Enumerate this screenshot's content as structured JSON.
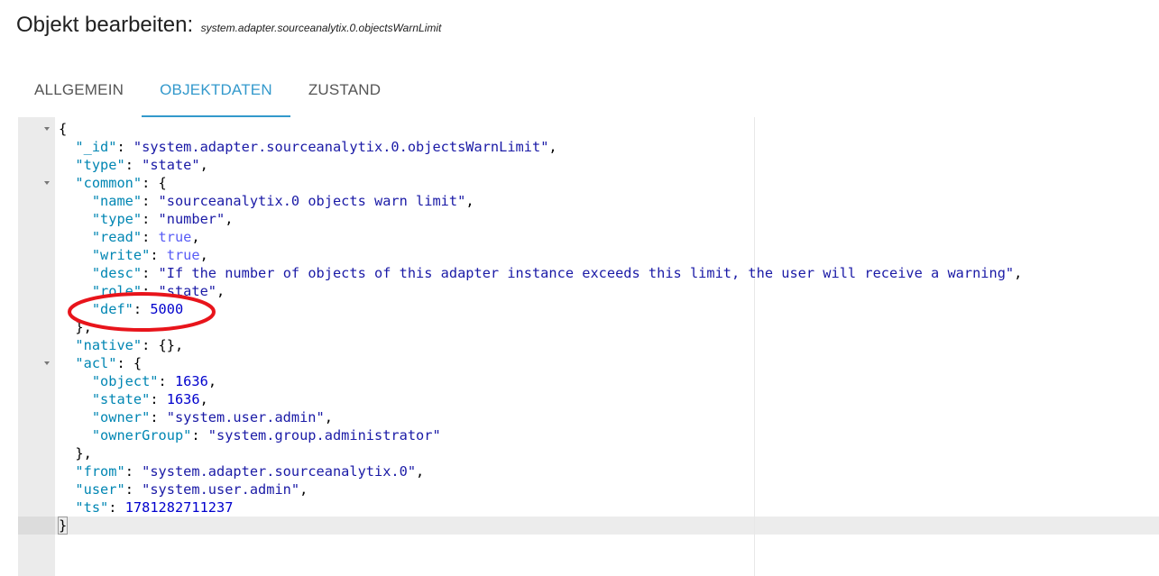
{
  "header": {
    "title": "Objekt bearbeiten:",
    "object_id": "system.adapter.sourceanalytix.0.objectsWarnLimit"
  },
  "tabs": [
    {
      "label": "ALLGEMEIN",
      "active": false
    },
    {
      "label": "OBJEKTDATEN",
      "active": true
    },
    {
      "label": "ZUSTAND",
      "active": false
    }
  ],
  "editor": {
    "lines": [
      "{",
      "  \"_id\": \"system.adapter.sourceanalytix.0.objectsWarnLimit\",",
      "  \"type\": \"state\",",
      "  \"common\": {",
      "    \"name\": \"sourceanalytix.0 objects warn limit\",",
      "    \"type\": \"number\",",
      "    \"read\": true,",
      "    \"write\": true,",
      "    \"desc\": \"If the number of objects of this adapter instance exceeds this limit, the user will receive a warning\",",
      "    \"role\": \"state\",",
      "    \"def\": 5000",
      "  },",
      "  \"native\": {},",
      "  \"acl\": {",
      "    \"object\": 1636,",
      "    \"state\": 1636,",
      "    \"owner\": \"system.user.admin\",",
      "    \"ownerGroup\": \"system.group.administrator\"",
      "  },",
      "  \"from\": \"system.adapter.sourceanalytix.0\",",
      "  \"user\": \"system.user.admin\",",
      "  \"ts\": 1781282711237",
      "}"
    ],
    "fold_lines": [
      0,
      3,
      13
    ],
    "active_line": 22
  },
  "annotation": {
    "color": "#e8141b"
  }
}
